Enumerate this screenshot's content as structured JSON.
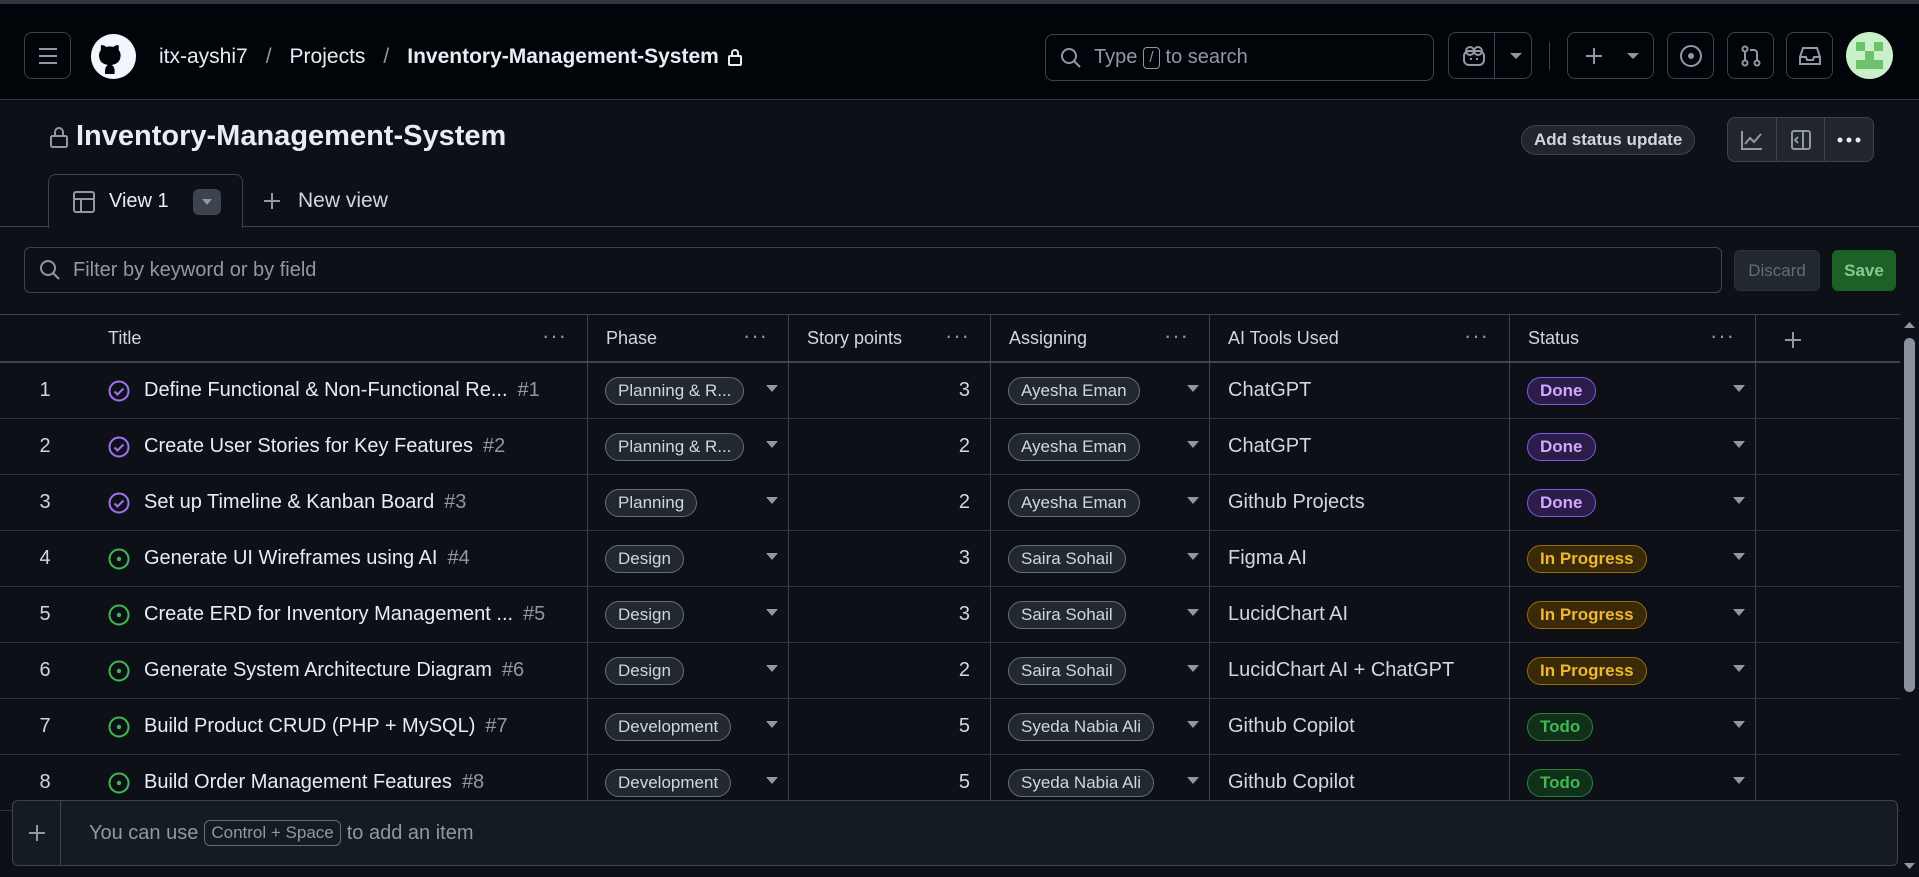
{
  "header": {
    "breadcrumb": {
      "owner": "itx-ayshi7",
      "section": "Projects",
      "project": "Inventory-Management-System",
      "sep1": "/",
      "sep2": "/"
    },
    "search": {
      "prefix": "Type",
      "key": "/",
      "suffix": "to search"
    }
  },
  "project": {
    "title": "Inventory-Management-System",
    "add_status_label": "Add status update"
  },
  "views": {
    "active_tab": "View 1",
    "new_view_label": "New view"
  },
  "filter": {
    "placeholder": "Filter by keyword or by field",
    "discard_label": "Discard",
    "save_label": "Save"
  },
  "table": {
    "columns": [
      "Title",
      "Phase",
      "Story points",
      "Assigning",
      "AI Tools Used",
      "Status"
    ],
    "rows": [
      {
        "n": "1",
        "title": "Define Functional & Non-Functional Re...",
        "issue": "#1",
        "phase": "Planning & R...",
        "points": "3",
        "assignee": "Ayesha Eman",
        "tool": "ChatGPT",
        "status": "Done",
        "kind": "done"
      },
      {
        "n": "2",
        "title": "Create User Stories for Key Features",
        "issue": "#2",
        "phase": "Planning & R...",
        "points": "2",
        "assignee": "Ayesha Eman",
        "tool": "ChatGPT",
        "status": "Done",
        "kind": "done"
      },
      {
        "n": "3",
        "title": "Set up Timeline & Kanban Board",
        "issue": "#3",
        "phase": "Planning",
        "points": "2",
        "assignee": "Ayesha Eman",
        "tool": "Github Projects",
        "status": "Done",
        "kind": "done"
      },
      {
        "n": "4",
        "title": "Generate UI Wireframes using AI",
        "issue": "#4",
        "phase": "Design",
        "points": "3",
        "assignee": "Saira Sohail",
        "tool": "Figma AI",
        "status": "In Progress",
        "kind": "prog"
      },
      {
        "n": "5",
        "title": "Create ERD for Inventory Management ...",
        "issue": "#5",
        "phase": "Design",
        "points": "3",
        "assignee": "Saira Sohail",
        "tool": "LucidChart AI",
        "status": "In Progress",
        "kind": "prog"
      },
      {
        "n": "6",
        "title": "Generate System Architecture Diagram",
        "issue": "#6",
        "phase": "Design",
        "points": "2",
        "assignee": "Saira Sohail",
        "tool": "LucidChart AI + ChatGPT",
        "status": "In Progress",
        "kind": "prog"
      },
      {
        "n": "7",
        "title": "Build Product CRUD (PHP + MySQL)",
        "issue": "#7",
        "phase": "Development",
        "points": "5",
        "assignee": "Syeda Nabia Ali",
        "tool": "Github Copilot",
        "status": "Todo",
        "kind": "todo"
      },
      {
        "n": "8",
        "title": "Build Order Management Features",
        "issue": "#8",
        "phase": "Development",
        "points": "5",
        "assignee": "Syeda Nabia Ali",
        "tool": "Github Copilot",
        "status": "Todo",
        "kind": "todo"
      }
    ]
  },
  "footer": {
    "prefix": "You can use",
    "shortcut": "Control + Space",
    "suffix": "to add an item"
  },
  "colors": {
    "done": "#a371f7",
    "in_progress": "#d29922",
    "todo": "#3fb950",
    "open_issue": "#3fb950",
    "closed_issue": "#a371f7"
  }
}
